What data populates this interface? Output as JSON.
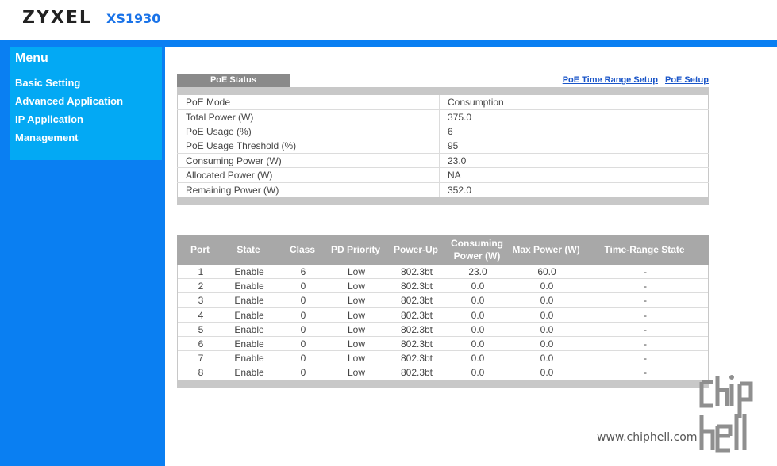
{
  "header": {
    "brand": "ZYXEL",
    "model": "XS1930"
  },
  "sidebar": {
    "title": "Menu",
    "items": [
      {
        "label": "Basic Setting"
      },
      {
        "label": "Advanced Application"
      },
      {
        "label": "IP Application"
      },
      {
        "label": "Management"
      }
    ]
  },
  "poe": {
    "tab": "PoE Status",
    "links": {
      "time_range": "PoE Time Range Setup",
      "setup": "PoE Setup"
    },
    "status": [
      {
        "label": "PoE Mode",
        "value": "Consumption"
      },
      {
        "label": "Total Power (W)",
        "value": "375.0"
      },
      {
        "label": "PoE Usage (%)",
        "value": "6"
      },
      {
        "label": "PoE Usage Threshold (%)",
        "value": "95"
      },
      {
        "label": "Consuming Power (W)",
        "value": "23.0"
      },
      {
        "label": "Allocated Power (W)",
        "value": "NA"
      },
      {
        "label": "Remaining Power (W)",
        "value": "352.0"
      }
    ]
  },
  "ports": {
    "headers": [
      "Port",
      "State",
      "Class",
      "PD Priority",
      "Power-Up",
      "Consuming Power (W)",
      "Max Power (W)",
      "Time-Range State"
    ],
    "rows": [
      [
        "1",
        "Enable",
        "6",
        "Low",
        "802.3bt",
        "23.0",
        "60.0",
        "-"
      ],
      [
        "2",
        "Enable",
        "0",
        "Low",
        "802.3bt",
        "0.0",
        "0.0",
        "-"
      ],
      [
        "3",
        "Enable",
        "0",
        "Low",
        "802.3bt",
        "0.0",
        "0.0",
        "-"
      ],
      [
        "4",
        "Enable",
        "0",
        "Low",
        "802.3bt",
        "0.0",
        "0.0",
        "-"
      ],
      [
        "5",
        "Enable",
        "0",
        "Low",
        "802.3bt",
        "0.0",
        "0.0",
        "-"
      ],
      [
        "6",
        "Enable",
        "0",
        "Low",
        "802.3bt",
        "0.0",
        "0.0",
        "-"
      ],
      [
        "7",
        "Enable",
        "0",
        "Low",
        "802.3bt",
        "0.0",
        "0.0",
        "-"
      ],
      [
        "8",
        "Enable",
        "0",
        "Low",
        "802.3bt",
        "0.0",
        "0.0",
        "-"
      ]
    ]
  },
  "watermark": {
    "text": "www.chiphell.com",
    "logo": "chip hell"
  }
}
